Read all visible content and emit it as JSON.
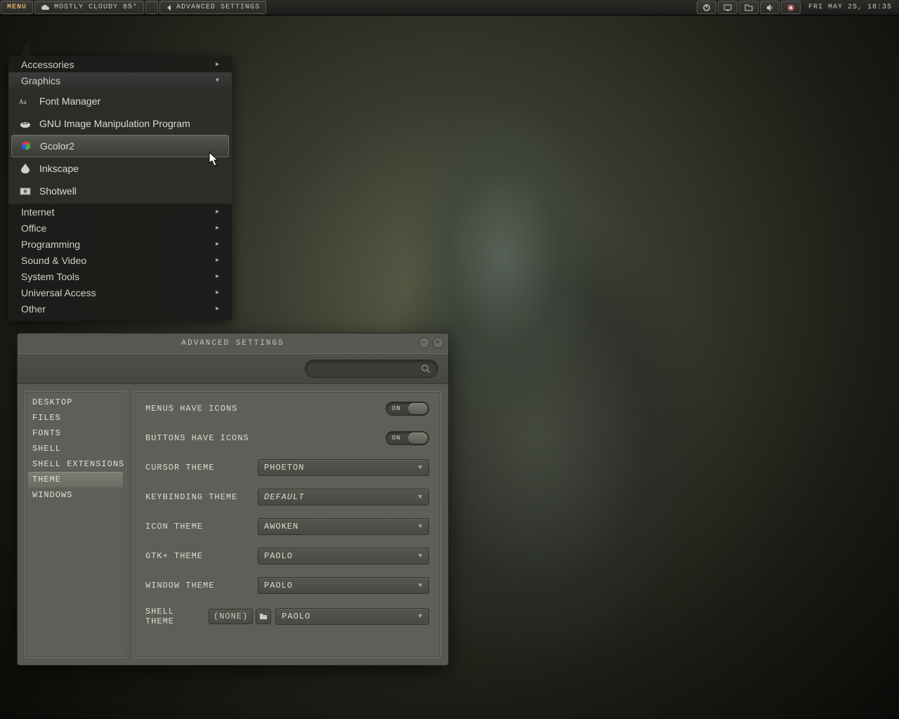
{
  "panel": {
    "menu_label": "MENU",
    "weather": "MOSTLY CLOUDY 85°",
    "active_window": "ADVANCED SETTINGS",
    "clock": "FRI MAY 25, 18:35"
  },
  "app_menu": {
    "categories": [
      {
        "label": "Accessories",
        "expanded": false
      },
      {
        "label": "Graphics",
        "expanded": true
      },
      {
        "label": "Internet",
        "expanded": false
      },
      {
        "label": "Office",
        "expanded": false
      },
      {
        "label": "Programming",
        "expanded": false
      },
      {
        "label": "Sound & Video",
        "expanded": false
      },
      {
        "label": "System Tools",
        "expanded": false
      },
      {
        "label": "Universal Access",
        "expanded": false
      },
      {
        "label": "Other",
        "expanded": false
      }
    ],
    "graphics_items": [
      {
        "label": "Font Manager",
        "icon": "font-icon"
      },
      {
        "label": "GNU Image Manipulation Program",
        "icon": "gimp-icon"
      },
      {
        "label": "Gcolor2",
        "icon": "cube-icon",
        "hover": true
      },
      {
        "label": "Inkscape",
        "icon": "inkscape-icon"
      },
      {
        "label": "Shotwell",
        "icon": "shotwell-icon"
      }
    ]
  },
  "settings": {
    "title": "ADVANCED SETTINGS",
    "search_placeholder": "",
    "sidebar": [
      "Desktop",
      "Files",
      "Fonts",
      "Shell",
      "Shell Extensions",
      "Theme",
      "Windows"
    ],
    "sidebar_selected": "Theme",
    "rows": {
      "menus_icons": {
        "label": "Menus have icons",
        "state": "ON"
      },
      "buttons_icons": {
        "label": "Buttons have icons",
        "state": "ON"
      },
      "cursor": {
        "label": "Cursor theme",
        "value": "phoeton"
      },
      "keybinding": {
        "label": "Keybinding theme",
        "value": "Default"
      },
      "icon": {
        "label": "Icon theme",
        "value": "awoken"
      },
      "gtk": {
        "label": "GTK+ theme",
        "value": "paolo"
      },
      "window": {
        "label": "Window theme",
        "value": "paolo"
      },
      "shell": {
        "label": "Shell theme",
        "none_label": "(None)",
        "value": "paolo"
      }
    }
  }
}
